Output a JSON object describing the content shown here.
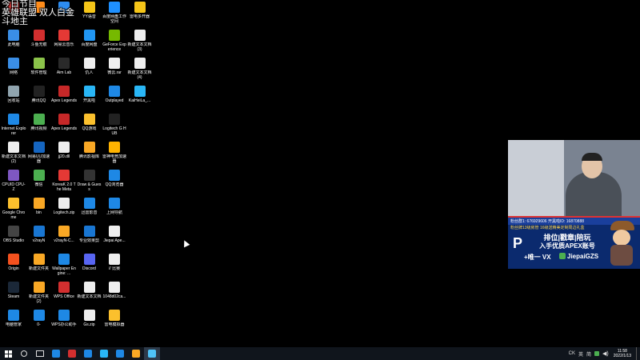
{
  "overlay": {
    "line1": "今日节目",
    "line2": "英雄联盟 双人白金",
    "line3": "斗地主"
  },
  "icons": [
    {
      "col": 0,
      "row": 0,
      "label": "",
      "icon": "app-icon",
      "color": "#c33"
    },
    {
      "col": 1,
      "row": 0,
      "label": "",
      "icon": "app-icon",
      "color": "#ff8c1a"
    },
    {
      "col": 2,
      "row": 0,
      "label": "",
      "icon": "app-icon",
      "color": "#2d8cf0"
    },
    {
      "col": 3,
      "row": 0,
      "label": "YY语音",
      "icon": "yy-icon",
      "color": "#f5c518"
    },
    {
      "col": 4,
      "row": 0,
      "label": "百度网盘工作空间",
      "icon": "baidu-netdisk-icon",
      "color": "#1e90ff"
    },
    {
      "col": 5,
      "row": 0,
      "label": "雷电多开器",
      "icon": "ldplayer-icon",
      "color": "#f5c518"
    },
    {
      "col": 0,
      "row": 1,
      "label": "此电脑",
      "icon": "computer-icon",
      "color": "#3a8ee6"
    },
    {
      "col": 1,
      "row": 1,
      "label": "斗鱼无痕",
      "icon": "app-icon",
      "color": "#d32f2f"
    },
    {
      "col": 2,
      "row": 1,
      "label": "网易云音乐",
      "icon": "netease-music-icon",
      "color": "#e53935"
    },
    {
      "col": 3,
      "row": 1,
      "label": "百度网盘",
      "icon": "baidu-netdisk-icon",
      "color": "#2196f3"
    },
    {
      "col": 4,
      "row": 1,
      "label": "GeForce Experience",
      "icon": "nvidia-icon",
      "color": "#76b900"
    },
    {
      "col": 5,
      "row": 1,
      "label": "新建文本文档 (3)",
      "icon": "text-file-icon",
      "color": "#eeeeee"
    },
    {
      "col": 0,
      "row": 2,
      "label": "网络",
      "icon": "network-icon",
      "color": "#3a8ee6"
    },
    {
      "col": 1,
      "row": 2,
      "label": "软件管理",
      "icon": "app-icon",
      "color": "#8bc34a"
    },
    {
      "col": 2,
      "row": 2,
      "label": "Aim Lab",
      "icon": "aimlab-icon",
      "color": "#2a2a2a"
    },
    {
      "col": 3,
      "row": 2,
      "label": "仇人",
      "icon": "text-file-icon",
      "color": "#eeeeee"
    },
    {
      "col": 4,
      "row": 2,
      "label": "微云.rar",
      "icon": "rar-icon",
      "color": "#eeeeee"
    },
    {
      "col": 5,
      "row": 2,
      "label": "新建文本文档 (4)",
      "icon": "text-file-icon",
      "color": "#eeeeee"
    },
    {
      "col": 0,
      "row": 3,
      "label": "回收站",
      "icon": "recycle-bin-icon",
      "color": "#90a4ae"
    },
    {
      "col": 1,
      "row": 3,
      "label": "腾讯QQ",
      "icon": "qq-icon",
      "color": "#222"
    },
    {
      "col": 2,
      "row": 3,
      "label": "Apex Legends",
      "icon": "apex-icon",
      "color": "#c62828"
    },
    {
      "col": 3,
      "row": 3,
      "label": "开黑啦",
      "icon": "kaiheila-icon",
      "color": "#29b6f6"
    },
    {
      "col": 4,
      "row": 3,
      "label": "Outplayed",
      "icon": "outplayed-icon",
      "color": "#1e88e5"
    },
    {
      "col": 5,
      "row": 3,
      "label": "KaiHeiLa_...",
      "icon": "kaiheila-icon",
      "color": "#29b6f6"
    },
    {
      "col": 0,
      "row": 4,
      "label": "Internet Explorer",
      "icon": "ie-icon",
      "color": "#1e88e5"
    },
    {
      "col": 1,
      "row": 4,
      "label": "腾讯视频",
      "icon": "tencent-video-icon",
      "color": "#4caf50"
    },
    {
      "col": 2,
      "row": 4,
      "label": "Apex Legends",
      "icon": "apex-icon",
      "color": "#c62828"
    },
    {
      "col": 3,
      "row": 4,
      "label": "QQ游戏",
      "icon": "qq-game-icon",
      "color": "#fbc02d"
    },
    {
      "col": 4,
      "row": 4,
      "label": "Logitech G HUB",
      "icon": "logitech-icon",
      "color": "#222"
    },
    {
      "col": 0,
      "row": 5,
      "label": "新建文本文档 (2)",
      "icon": "text-file-icon",
      "color": "#eeeeee"
    },
    {
      "col": 1,
      "row": 5,
      "label": "网易UU加速器",
      "icon": "uu-icon",
      "color": "#1565c0"
    },
    {
      "col": 2,
      "row": 5,
      "label": "jj20.dll",
      "icon": "file-icon",
      "color": "#eeeeee"
    },
    {
      "col": 3,
      "row": 5,
      "label": "腾讯影视库",
      "icon": "folder-icon",
      "color": "#f9a825"
    },
    {
      "col": 4,
      "row": 5,
      "label": "雷神电竞加速器",
      "icon": "app-icon",
      "color": "#ffb300"
    },
    {
      "col": 0,
      "row": 6,
      "label": "CPUID CPU-Z",
      "icon": "cpuz-icon",
      "color": "#7e57c2"
    },
    {
      "col": 1,
      "row": 6,
      "label": "微信",
      "icon": "wechat-icon",
      "color": "#4caf50"
    },
    {
      "col": 2,
      "row": 6,
      "label": "KoreaK 2.0 The Meta",
      "icon": "app-icon",
      "color": "#e53935"
    },
    {
      "col": 3,
      "row": 6,
      "label": "Draw & Guess",
      "icon": "pencil-icon",
      "color": "#333"
    },
    {
      "col": 4,
      "row": 6,
      "label": "QQ浏览器",
      "icon": "qq-browser-icon",
      "color": "#1e88e5"
    },
    {
      "col": 0,
      "row": 7,
      "label": "Google Chrome",
      "icon": "chrome-icon",
      "color": "#fbc02d"
    },
    {
      "col": 1,
      "row": 7,
      "label": "bin",
      "icon": "folder-icon",
      "color": "#f9a825"
    },
    {
      "col": 2,
      "row": 7,
      "label": "Logitech.zip",
      "icon": "zip-icon",
      "color": "#eeeeee"
    },
    {
      "col": 3,
      "row": 7,
      "label": "迅雷影音",
      "icon": "player-icon",
      "color": "#1e88e5"
    },
    {
      "col": 4,
      "row": 7,
      "label": "上网导航",
      "icon": "ie-icon",
      "color": "#1e88e5"
    },
    {
      "col": 0,
      "row": 8,
      "label": "OBS Studio",
      "icon": "obs-icon",
      "color": "#444"
    },
    {
      "col": 1,
      "row": 8,
      "label": "v2rayN",
      "icon": "app-icon",
      "color": "#1976d2"
    },
    {
      "col": 2,
      "row": 8,
      "label": "v2rayN-C...",
      "icon": "folder-icon",
      "color": "#f9a825"
    },
    {
      "col": 3,
      "row": 8,
      "label": "专业效果剪",
      "icon": "app-icon",
      "color": "#1976d2"
    },
    {
      "col": 4,
      "row": 8,
      "label": "Jiepai Ape...",
      "icon": "text-file-icon",
      "color": "#eeeeee"
    },
    {
      "col": 0,
      "row": 9,
      "label": "Origin",
      "icon": "origin-icon",
      "color": "#f4511e"
    },
    {
      "col": 1,
      "row": 9,
      "label": "新建文件夹",
      "icon": "folder-icon",
      "color": "#f9a825"
    },
    {
      "col": 2,
      "row": 9,
      "label": "Wallpaper Engine: ...",
      "icon": "wallpaper-engine-icon",
      "color": "#1e88e5"
    },
    {
      "col": 3,
      "row": 9,
      "label": "Discord",
      "icon": "discord-icon",
      "color": "#5865f2"
    },
    {
      "col": 4,
      "row": 9,
      "label": "// 比赛",
      "icon": "text-file-icon",
      "color": "#eeeeee"
    },
    {
      "col": 0,
      "row": 10,
      "label": "Steam",
      "icon": "steam-icon",
      "color": "#1b2838"
    },
    {
      "col": 1,
      "row": 10,
      "label": "新建文件夹 (2)",
      "icon": "folder-icon",
      "color": "#f9a825"
    },
    {
      "col": 2,
      "row": 10,
      "label": "WPS Office",
      "icon": "wps-icon",
      "color": "#d32f2f"
    },
    {
      "col": 3,
      "row": 10,
      "label": "新建文本文档",
      "icon": "text-file-icon",
      "color": "#eeeeee"
    },
    {
      "col": 4,
      "row": 10,
      "label": "1048d02ca...",
      "icon": "file-icon",
      "color": "#eeeeee"
    },
    {
      "col": 0,
      "row": 11,
      "label": "电脑管家",
      "icon": "pc-manager-icon",
      "color": "#1e88e5"
    },
    {
      "col": 1,
      "row": 11,
      "label": "0-",
      "icon": "app-icon",
      "color": "#1e88e5"
    },
    {
      "col": 2,
      "row": 11,
      "label": "WPS办公助手",
      "icon": "cube-icon",
      "color": "#1e88e5"
    },
    {
      "col": 3,
      "row": 11,
      "label": "Gs.zip",
      "icon": "zip-icon",
      "color": "#eeeeee"
    },
    {
      "col": 4,
      "row": 11,
      "label": "雷电模拟器",
      "icon": "ldplayer-icon",
      "color": "#fbc02d"
    }
  ],
  "promo": {
    "top_line": "粉丝群1: 676929606  开黑啦ID: 16870888",
    "sub_line": "粉丝牌13级房管  16级送精美定制周边礼盒",
    "logo": "P",
    "main1": "排位|戳章|陪玩",
    "main2": "入手优质APEX账号",
    "main3": "+唯一 VX",
    "vx_id": "JiepaiGZS"
  },
  "taskbar": {
    "pinned": [
      {
        "icon": "windows-start-icon",
        "color": "#fff"
      },
      {
        "icon": "search-icon",
        "color": "#ddd"
      },
      {
        "icon": "task-view-icon",
        "color": "#ddd"
      },
      {
        "icon": "ie-icon",
        "color": "#1e88e5"
      },
      {
        "icon": "app-icon",
        "color": "#d32f2f"
      },
      {
        "icon": "qq-browser-icon",
        "color": "#1e88e5"
      },
      {
        "icon": "kaiheila-icon",
        "color": "#29b6f6"
      },
      {
        "icon": "qq-browser-icon",
        "color": "#1e88e5"
      },
      {
        "icon": "file-explorer-icon",
        "color": "#f9a825"
      },
      {
        "icon": "active-app-icon",
        "color": "#4fc3f7"
      }
    ],
    "tray_text": "CK",
    "ime_lang": "英",
    "ime_mode": "简",
    "time": "11:58",
    "date": "2022/1/13"
  }
}
